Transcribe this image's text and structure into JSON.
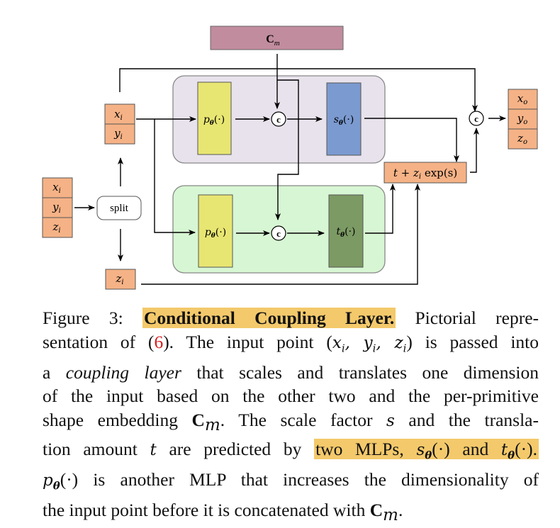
{
  "diagram": {
    "embedding_label": "C",
    "embedding_sub": "m",
    "input_top": [
      "x",
      "y"
    ],
    "input_top_sub": "i",
    "input_full": [
      "x",
      "y",
      "z"
    ],
    "input_full_sub": "i",
    "split_label": "split",
    "z_input": "z",
    "z_input_sub": "i",
    "p_label": "p",
    "theta_sub": "θ",
    "fn_suffix": "(·)",
    "s_label": "s",
    "t_label": "t",
    "concat_label": "c",
    "affine_label": "t + z",
    "affine_sub": "i",
    "affine_tail": " exp(s)",
    "output": [
      "x",
      "y",
      "z"
    ],
    "output_sub": "o",
    "colors": {
      "embedding": "#c18c9e",
      "orange": "#f5b286",
      "purple_bg": "#e8e2ec",
      "green_bg": "#d7f6d3",
      "yellow": "#e8e672",
      "blue": "#7b9ad0",
      "dark_green": "#7c9a64"
    }
  },
  "caption": {
    "figure_label": "Figure 3:",
    "title": "Conditional Coupling Layer.",
    "l1_rest": "Pictorial repre-",
    "l2_a": "sentation of (",
    "l2_ref": "6",
    "l2_b": "). The input point (",
    "l2_math": "x",
    "l2_c": ") is passed into",
    "l3_a": "a ",
    "l3_ital": "coupling layer",
    "l3_b": " that scales and translates one dimension",
    "l4": "of the input based on the other two and the per-primitive",
    "l5_a": "shape embedding ",
    "l5_b": ". The scale factor ",
    "l5_s": "s",
    "l5_c": " and the transla-",
    "l6_a": "tion amount ",
    "l6_t": "t",
    "l6_b": " are predicted by ",
    "l6_hl": "two MLPs, ",
    "l6_and": " and ",
    "l7_a": " is another MLP that increases the dimensionality of",
    "l8_a": "the input point before it is concatenated with "
  }
}
